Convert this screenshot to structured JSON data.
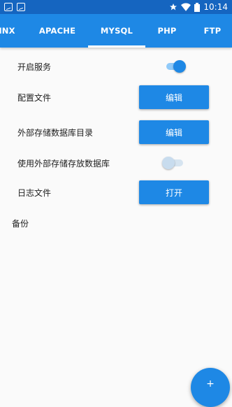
{
  "status_bar": {
    "time": "10:14",
    "icons": [
      "notification-icon",
      "notification-icon",
      "star-icon",
      "wifi-icon",
      "battery-icon"
    ]
  },
  "tabs": [
    {
      "label": "INX"
    },
    {
      "label": "APACHE"
    },
    {
      "label": "MYSQL",
      "selected": true
    },
    {
      "label": "PHP"
    },
    {
      "label": "FTP"
    }
  ],
  "settings": {
    "service": {
      "label": "开启服务",
      "enabled": true
    },
    "config_file": {
      "label": "配置文件",
      "button": "编辑"
    },
    "external_dir": {
      "label": "外部存储数据库目录",
      "button": "编辑"
    },
    "use_external": {
      "label": "使用外部存储存放数据库",
      "enabled": false
    },
    "log_file": {
      "label": "日志文件",
      "button": "打开"
    }
  },
  "backup": {
    "title": "备份"
  },
  "fab": {
    "label": "+"
  },
  "colors": {
    "primary": "#1e88e5",
    "status_bar": "#1565c0",
    "background": "#fafafa"
  }
}
